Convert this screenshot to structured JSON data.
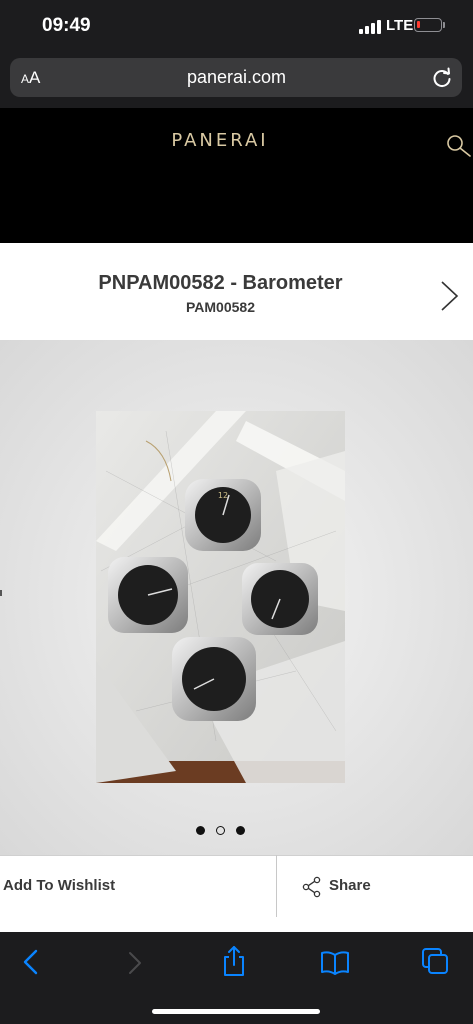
{
  "status_bar": {
    "time": "09:49",
    "network": "LTE"
  },
  "browser": {
    "text_size_label": "AA",
    "url": "panerai.com"
  },
  "site": {
    "logo": "PANERAI"
  },
  "product": {
    "title": "PNPAM00582 - Barometer",
    "reference": "PAM00582",
    "gallery": {
      "total": 3,
      "active_index": 0
    }
  },
  "actions": {
    "wishlist_label": "Add To Wishlist",
    "share_label": "Share"
  },
  "colors": {
    "accent": "#0a84ff",
    "logo": "#d9c9a3",
    "battery_low": "#ff3b30"
  },
  "icons": {
    "reload": "reload-icon",
    "search": "search-icon",
    "next": "chevron-right-icon",
    "share": "share-icon",
    "back": "back-icon",
    "forward": "forward-icon",
    "share_sheet": "share-sheet-icon",
    "bookmarks": "bookmarks-icon",
    "tabs": "tabs-icon"
  }
}
